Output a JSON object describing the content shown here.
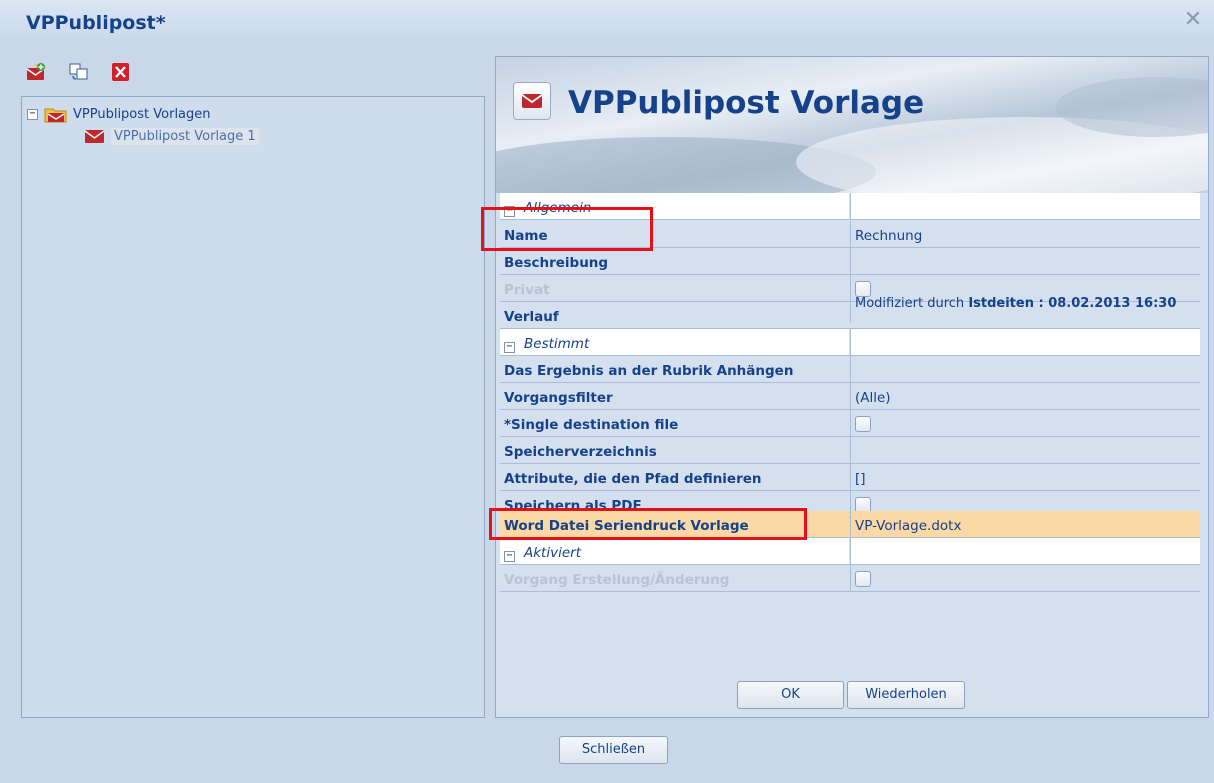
{
  "window": {
    "title": "VPPublipost*",
    "close_glyph": "✕"
  },
  "toolbar": {
    "icons": [
      "add-template-icon",
      "copy-icon",
      "delete-icon"
    ]
  },
  "tree": {
    "root_label": "VPPublipost Vorlagen",
    "root_toggle": "−",
    "child_label": "VPPublipost Vorlage 1"
  },
  "banner": {
    "title": "VPPublipost Vorlage"
  },
  "properties": {
    "cat_allgemein": "Allgemein",
    "cat_bestimmt": "Bestimmt",
    "cat_aktiviert": "Aktiviert",
    "cat_toggle": "−",
    "rows": {
      "name": {
        "label": "Name",
        "value": "Rechnung"
      },
      "beschreibung": {
        "label": "Beschreibung",
        "value": ""
      },
      "privat": {
        "label": "Privat"
      },
      "verlauf": {
        "label": "Verlauf",
        "value_prefix": "Modifiziert durch ",
        "value_user": "Istdeiten",
        "value_suffix": " : 08.02.2013 16:30"
      },
      "ergebnis": {
        "label": "Das Ergebnis an der Rubrik Anhängen",
        "value": ""
      },
      "vorgangsfilter": {
        "label": "Vorgangsfilter",
        "value": "(Alle)"
      },
      "single": {
        "label": "*Single destination file"
      },
      "speicherverzeichnis": {
        "label": "Speicherverzeichnis",
        "value": ""
      },
      "attribute": {
        "label": "Attribute, die den Pfad definieren",
        "value": "[]"
      },
      "pdf": {
        "label": "Speichern als PDF"
      },
      "word": {
        "label": "Word Datei Seriendruck Vorlage",
        "value": "VP-Vorlage.dotx"
      },
      "vorgang": {
        "label": "Vorgang Erstellung/Änderung"
      }
    }
  },
  "buttons": {
    "ok": "OK",
    "wiederholen": "Wiederholen",
    "schliessen": "Schließen"
  },
  "colors": {
    "accent": "#15428b",
    "highlight": "#fad9a4",
    "annotation": "#e3121a"
  }
}
